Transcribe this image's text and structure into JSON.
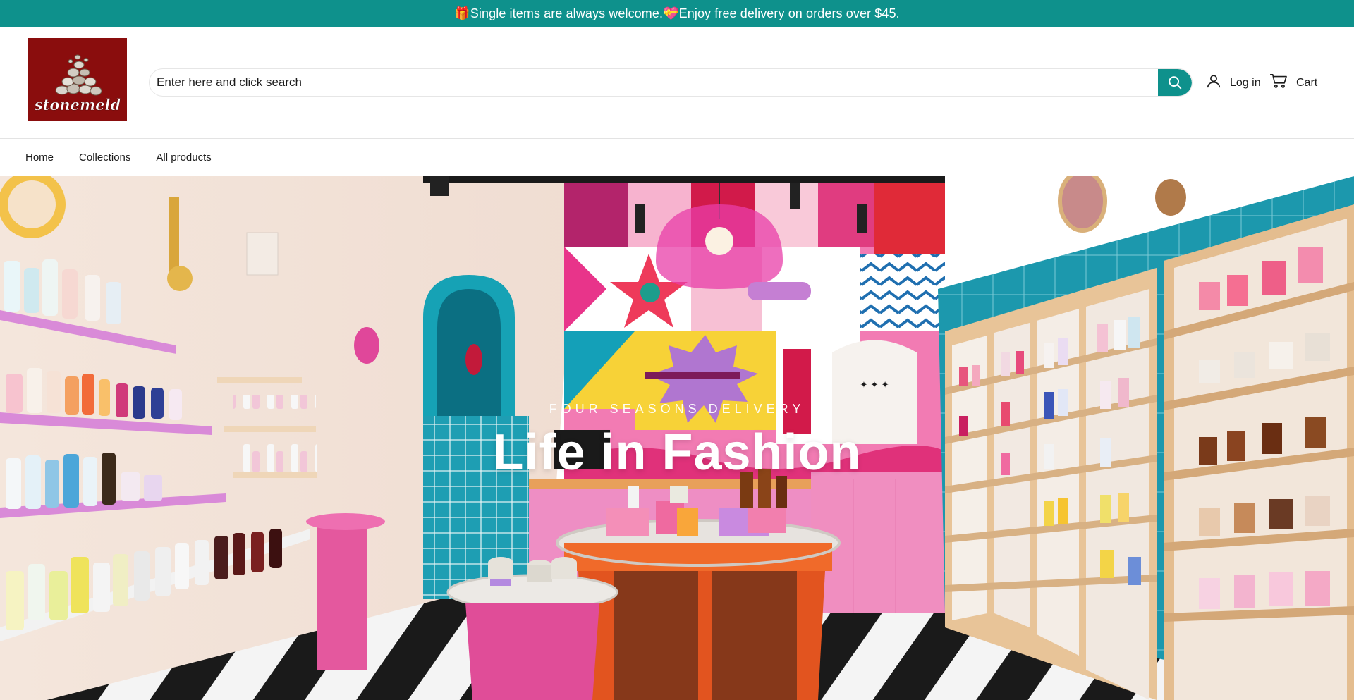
{
  "announcement": {
    "gift_icon": "gift-icon",
    "part1": "Single items are always welcome.",
    "heart_icon": "heart-gift-icon",
    "part2": "Enjoy free delivery on orders over $45.",
    "bg_color": "#0e918c"
  },
  "header": {
    "logo_text": "stonemeld",
    "search": {
      "placeholder": "Enter here and click search",
      "button_icon": "search-icon"
    },
    "login_label": "Log in",
    "cart_label": "Cart"
  },
  "nav": {
    "items": [
      {
        "label": "Home"
      },
      {
        "label": "Collections"
      },
      {
        "label": "All products"
      }
    ]
  },
  "hero": {
    "subtitle": "FOUR SEASONS DELIVERY",
    "title": "Life in Fashion"
  },
  "colors": {
    "accent": "#0e918c",
    "logo_bg": "#8a0d0d"
  }
}
